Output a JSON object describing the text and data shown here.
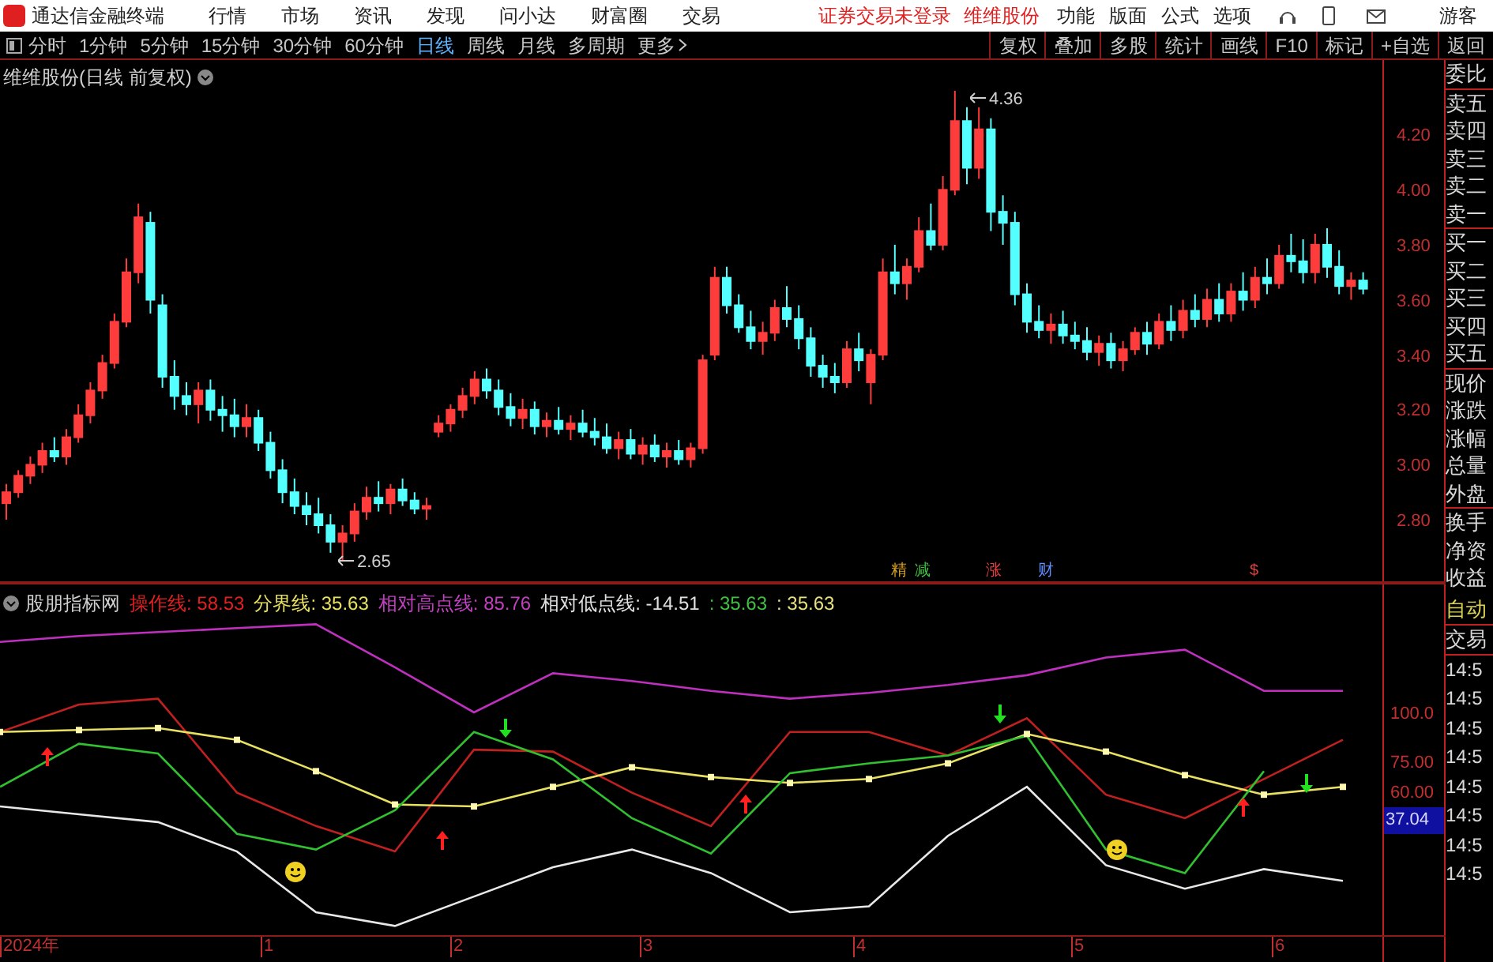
{
  "app": {
    "title": "通达信金融终端",
    "menu": [
      "行情",
      "市场",
      "资讯",
      "发现",
      "问小达",
      "财富圈",
      "交易"
    ],
    "notices": [
      "证券交易未登录",
      "维维股份"
    ],
    "tools": [
      "功能",
      "版面",
      "公式",
      "选项"
    ],
    "user": "游客"
  },
  "toolbar": {
    "periods": [
      {
        "label": "分时",
        "selected": false
      },
      {
        "label": "1分钟",
        "selected": false
      },
      {
        "label": "5分钟",
        "selected": false
      },
      {
        "label": "15分钟",
        "selected": false
      },
      {
        "label": "30分钟",
        "selected": false
      },
      {
        "label": "60分钟",
        "selected": false
      },
      {
        "label": "日线",
        "selected": true
      },
      {
        "label": "周线",
        "selected": false
      },
      {
        "label": "月线",
        "selected": false
      },
      {
        "label": "多周期",
        "selected": false
      }
    ],
    "more": "更多",
    "actions": [
      "复权",
      "叠加",
      "多股",
      "统计",
      "画线",
      "F10",
      "标记",
      "+自选",
      "返回"
    ]
  },
  "main_chart": {
    "title": "维维股份(日线 前复权)",
    "high_label": "4.36",
    "low_label": "2.65",
    "event_marks": [
      {
        "label": "精",
        "color": "#d8a020"
      },
      {
        "label": "减",
        "color": "#40c040"
      },
      {
        "label": "涨",
        "color": "#e04040"
      },
      {
        "label": "财",
        "color": "#6090ff"
      },
      {
        "label": "$",
        "color": "#e04040"
      }
    ],
    "chart_data": {
      "type": "candlestick",
      "ylim": [
        2.576,
        4.472
      ],
      "categories": [
        null,
        null,
        null,
        null,
        null,
        null,
        null,
        null,
        null,
        null,
        null,
        null,
        null,
        null,
        null,
        null,
        null,
        null,
        null,
        null,
        null,
        null,
        null,
        null,
        null,
        null,
        null,
        null,
        null,
        null,
        null,
        null,
        null,
        null,
        null,
        null,
        null,
        null,
        null,
        null,
        null,
        null,
        null,
        null,
        null,
        null,
        null,
        null,
        null,
        null,
        null,
        null,
        null,
        null,
        null,
        null,
        null,
        null,
        null,
        null,
        null,
        null,
        null,
        null,
        null,
        null,
        null,
        null,
        null,
        null,
        null,
        null,
        null,
        null,
        null,
        null,
        null,
        null,
        null,
        null,
        null,
        null,
        null,
        null,
        null,
        null,
        null,
        null,
        null,
        null,
        null,
        null,
        null,
        null,
        null,
        null,
        null,
        null,
        null,
        null,
        null,
        null,
        null,
        null,
        null,
        null,
        null,
        null,
        null,
        null,
        null,
        null,
        null,
        null
      ],
      "yticks": [
        {
          "value": 4.2,
          "label": "4.20"
        },
        {
          "value": 4.0,
          "label": "4.00"
        },
        {
          "value": 3.8,
          "label": "3.80"
        },
        {
          "value": 3.6,
          "label": "3.60"
        },
        {
          "value": 3.4,
          "label": "3.40"
        },
        {
          "value": 3.2,
          "label": "3.20"
        },
        {
          "value": 3.0,
          "label": "3.00"
        },
        {
          "value": 2.8,
          "label": "2.80"
        }
      ],
      "ohlc": [
        [
          2.86,
          2.93,
          2.8,
          2.9
        ],
        [
          2.9,
          2.98,
          2.88,
          2.96
        ],
        [
          2.96,
          3.03,
          2.93,
          3.0
        ],
        [
          3.0,
          3.08,
          2.97,
          3.05
        ],
        [
          3.05,
          3.1,
          3.01,
          3.03
        ],
        [
          3.03,
          3.13,
          3.0,
          3.1
        ],
        [
          3.1,
          3.22,
          3.08,
          3.18
        ],
        [
          3.18,
          3.3,
          3.15,
          3.27
        ],
        [
          3.27,
          3.4,
          3.24,
          3.37
        ],
        [
          3.37,
          3.55,
          3.35,
          3.52
        ],
        [
          3.52,
          3.75,
          3.5,
          3.7
        ],
        [
          3.7,
          3.95,
          3.66,
          3.9
        ],
        [
          3.88,
          3.92,
          3.55,
          3.6
        ],
        [
          3.58,
          3.62,
          3.28,
          3.32
        ],
        [
          3.32,
          3.38,
          3.2,
          3.25
        ],
        [
          3.25,
          3.3,
          3.18,
          3.22
        ],
        [
          3.22,
          3.3,
          3.15,
          3.27
        ],
        [
          3.27,
          3.31,
          3.16,
          3.2
        ],
        [
          3.2,
          3.25,
          3.12,
          3.18
        ],
        [
          3.18,
          3.24,
          3.1,
          3.14
        ],
        [
          3.14,
          3.22,
          3.1,
          3.17
        ],
        [
          3.17,
          3.2,
          3.05,
          3.08
        ],
        [
          3.08,
          3.12,
          2.95,
          2.98
        ],
        [
          2.98,
          3.02,
          2.86,
          2.9
        ],
        [
          2.9,
          2.95,
          2.82,
          2.85
        ],
        [
          2.85,
          2.9,
          2.78,
          2.82
        ],
        [
          2.82,
          2.88,
          2.75,
          2.78
        ],
        [
          2.78,
          2.82,
          2.68,
          2.72
        ],
        [
          2.72,
          2.78,
          2.65,
          2.75
        ],
        [
          2.75,
          2.86,
          2.72,
          2.83
        ],
        [
          2.83,
          2.92,
          2.8,
          2.88
        ],
        [
          2.88,
          2.94,
          2.83,
          2.86
        ],
        [
          2.86,
          2.93,
          2.82,
          2.91
        ],
        [
          2.91,
          2.95,
          2.85,
          2.87
        ],
        [
          2.87,
          2.9,
          2.82,
          2.84
        ],
        [
          2.84,
          2.88,
          2.8,
          2.85
        ],
        [
          3.12,
          3.18,
          3.1,
          3.15
        ],
        [
          3.15,
          3.22,
          3.12,
          3.2
        ],
        [
          3.2,
          3.28,
          3.17,
          3.25
        ],
        [
          3.25,
          3.34,
          3.22,
          3.31
        ],
        [
          3.31,
          3.35,
          3.24,
          3.27
        ],
        [
          3.27,
          3.31,
          3.18,
          3.21
        ],
        [
          3.21,
          3.26,
          3.14,
          3.17
        ],
        [
          3.17,
          3.24,
          3.13,
          3.2
        ],
        [
          3.2,
          3.23,
          3.11,
          3.14
        ],
        [
          3.14,
          3.19,
          3.1,
          3.16
        ],
        [
          3.16,
          3.21,
          3.11,
          3.13
        ],
        [
          3.13,
          3.18,
          3.09,
          3.15
        ],
        [
          3.15,
          3.2,
          3.1,
          3.12
        ],
        [
          3.12,
          3.17,
          3.07,
          3.1
        ],
        [
          3.1,
          3.15,
          3.04,
          3.06
        ],
        [
          3.06,
          3.12,
          3.02,
          3.09
        ],
        [
          3.09,
          3.13,
          3.02,
          3.04
        ],
        [
          3.04,
          3.1,
          3.0,
          3.07
        ],
        [
          3.07,
          3.11,
          3.01,
          3.03
        ],
        [
          3.03,
          3.08,
          2.99,
          3.05
        ],
        [
          3.05,
          3.09,
          3.0,
          3.02
        ],
        [
          3.02,
          3.08,
          2.99,
          3.06
        ],
        [
          3.06,
          3.4,
          3.04,
          3.38
        ],
        [
          3.4,
          3.72,
          3.38,
          3.68
        ],
        [
          3.68,
          3.72,
          3.55,
          3.58
        ],
        [
          3.58,
          3.62,
          3.48,
          3.5
        ],
        [
          3.5,
          3.56,
          3.42,
          3.45
        ],
        [
          3.45,
          3.52,
          3.4,
          3.48
        ],
        [
          3.48,
          3.6,
          3.45,
          3.57
        ],
        [
          3.57,
          3.65,
          3.5,
          3.53
        ],
        [
          3.53,
          3.58,
          3.42,
          3.46
        ],
        [
          3.46,
          3.5,
          3.32,
          3.36
        ],
        [
          3.36,
          3.4,
          3.28,
          3.32
        ],
        [
          3.32,
          3.37,
          3.26,
          3.3
        ],
        [
          3.3,
          3.45,
          3.28,
          3.42
        ],
        [
          3.42,
          3.48,
          3.34,
          3.38
        ],
        [
          3.3,
          3.42,
          3.22,
          3.4
        ],
        [
          3.4,
          3.75,
          3.38,
          3.7
        ],
        [
          3.7,
          3.8,
          3.62,
          3.66
        ],
        [
          3.66,
          3.75,
          3.6,
          3.72
        ],
        [
          3.72,
          3.9,
          3.7,
          3.85
        ],
        [
          3.85,
          3.95,
          3.78,
          3.8
        ],
        [
          3.8,
          4.05,
          3.78,
          4.0
        ],
        [
          4.0,
          4.36,
          3.98,
          4.25
        ],
        [
          4.25,
          4.3,
          4.02,
          4.08
        ],
        [
          4.08,
          4.3,
          4.04,
          4.22
        ],
        [
          4.22,
          4.26,
          3.85,
          3.92
        ],
        [
          3.92,
          3.98,
          3.8,
          3.88
        ],
        [
          3.88,
          3.92,
          3.58,
          3.62
        ],
        [
          3.62,
          3.66,
          3.48,
          3.52
        ],
        [
          3.52,
          3.58,
          3.46,
          3.49
        ],
        [
          3.49,
          3.55,
          3.44,
          3.51
        ],
        [
          3.51,
          3.56,
          3.44,
          3.47
        ],
        [
          3.47,
          3.52,
          3.42,
          3.45
        ],
        [
          3.45,
          3.5,
          3.38,
          3.41
        ],
        [
          3.41,
          3.47,
          3.36,
          3.44
        ],
        [
          3.44,
          3.48,
          3.35,
          3.38
        ],
        [
          3.38,
          3.45,
          3.34,
          3.42
        ],
        [
          3.42,
          3.5,
          3.4,
          3.48
        ],
        [
          3.48,
          3.52,
          3.4,
          3.44
        ],
        [
          3.44,
          3.55,
          3.42,
          3.52
        ],
        [
          3.52,
          3.58,
          3.45,
          3.49
        ],
        [
          3.49,
          3.6,
          3.46,
          3.56
        ],
        [
          3.56,
          3.62,
          3.5,
          3.53
        ],
        [
          3.53,
          3.64,
          3.5,
          3.6
        ],
        [
          3.6,
          3.66,
          3.52,
          3.55
        ],
        [
          3.55,
          3.66,
          3.52,
          3.63
        ],
        [
          3.63,
          3.7,
          3.56,
          3.6
        ],
        [
          3.6,
          3.72,
          3.57,
          3.68
        ],
        [
          3.68,
          3.75,
          3.62,
          3.66
        ],
        [
          3.66,
          3.8,
          3.64,
          3.76
        ],
        [
          3.76,
          3.84,
          3.7,
          3.74
        ],
        [
          3.74,
          3.82,
          3.66,
          3.7
        ],
        [
          3.7,
          3.84,
          3.66,
          3.8
        ],
        [
          3.8,
          3.86,
          3.68,
          3.72
        ],
        [
          3.72,
          3.78,
          3.62,
          3.65
        ],
        [
          3.65,
          3.7,
          3.6,
          3.67
        ],
        [
          3.67,
          3.7,
          3.62,
          3.64
        ]
      ]
    }
  },
  "indicator": {
    "name": "股朋指标网",
    "legend": [
      {
        "text": "操作线: 58.53",
        "color": "#e02020"
      },
      {
        "text": "分界线: 35.63",
        "color": "#e8e060"
      },
      {
        "text": "相对高点线: 85.76",
        "color": "#c040c0"
      },
      {
        "text": "相对低点线: -14.51",
        "color": "#e0e0e0"
      },
      {
        "text": ": 35.63",
        "color": "#40c040"
      },
      {
        "text": ": 35.63",
        "color": "#e8e080"
      }
    ],
    "current": "37.04",
    "chart_data": {
      "type": "line",
      "ylim": [
        -14.5,
        165.3
      ],
      "yticks": [
        {
          "value": 100,
          "label": "100.0"
        },
        {
          "value": 75,
          "label": "75.00"
        },
        {
          "value": 60,
          "label": "60.00"
        }
      ],
      "series": [
        {
          "color": "#c030c0",
          "values": [
            136,
            139,
            141,
            143,
            145,
            123,
            100,
            120,
            116,
            111,
            107,
            110,
            114,
            119,
            128,
            132,
            111,
            111
          ]
        },
        {
          "color": "#c02020",
          "values": [
            90,
            104,
            107,
            59,
            42,
            29,
            81,
            80,
            59,
            42,
            90,
            90,
            78,
            97,
            58,
            46,
            66,
            86
          ]
        },
        {
          "color": "#e8e060",
          "marker": "square",
          "values": [
            90,
            91,
            92,
            86,
            70,
            53,
            52,
            62,
            72,
            67,
            64,
            66,
            74,
            89,
            80,
            68,
            58,
            62
          ]
        },
        {
          "color": "#30c030",
          "values": [
            62,
            84,
            79,
            38,
            30,
            50,
            90,
            76,
            46,
            28,
            69,
            74,
            78,
            88,
            30,
            18,
            70,
            null
          ]
        },
        {
          "color": "#e8e8e8",
          "values": [
            52,
            48,
            44,
            29,
            -2,
            -9,
            6,
            21,
            30,
            18,
            -2,
            1,
            37,
            62,
            22,
            10,
            20,
            14
          ]
        }
      ]
    }
  },
  "side_panel": {
    "quote_labels": [
      "委比",
      "卖五",
      "卖四",
      "卖三",
      "卖二",
      "卖一",
      "买一",
      "买二",
      "买三",
      "买四",
      "买五",
      "现价",
      "涨跌",
      "涨幅",
      "总量",
      "外盘",
      "换手",
      "净资",
      "收益"
    ],
    "trade_labels": [
      "自动",
      "交易"
    ],
    "times": [
      "14:5",
      "14:5",
      "14:5",
      "14:5",
      "14:5",
      "14:5",
      "14:5",
      "14:5"
    ]
  },
  "date_axis": [
    "2024年",
    "1",
    "2",
    "3",
    "4",
    "5",
    "6"
  ]
}
